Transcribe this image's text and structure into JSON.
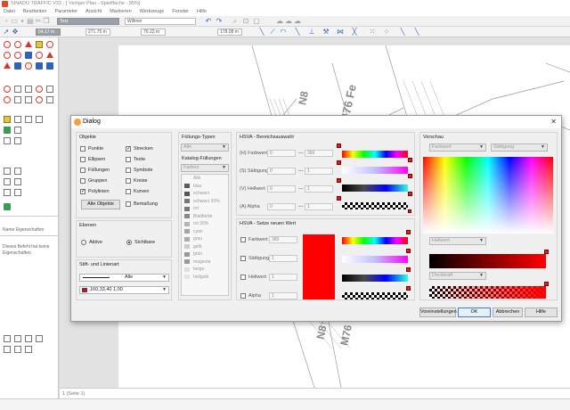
{
  "app": {
    "title": "SINADO TRAFFIC V32 - [ Verliger Plan - Spielfläche - 95%]",
    "menu": [
      "Datei",
      "Bearbeiten",
      "Parameter",
      "Ansicht",
      "Markieren",
      "Werkzeuge",
      "Fenster",
      "Hilfe"
    ],
    "toolbar": {
      "layer_select": "Text",
      "style_select": "Willmer"
    },
    "coords": {
      "x": "54.17 m",
      "y": "271.75 m",
      "w": "76.22 m",
      "h": "178.08 m"
    },
    "left_panel": {
      "properties_label": "Name Eigenschaften",
      "info_text": "Dieses Befehl hat keine Eigenschaften"
    },
    "status": {
      "page": "1 (Seite 1)"
    },
    "map_labels": [
      "N8",
      "M76 Fe",
      "N8↑",
      "M76"
    ]
  },
  "dialog": {
    "title": "Dialog",
    "close_glyph": "✕",
    "objekte": {
      "title": "Objekte",
      "items": [
        {
          "label": "Punkte",
          "checked": false
        },
        {
          "label": "Strecken",
          "checked": true
        },
        {
          "label": "Ellipsen",
          "checked": false
        },
        {
          "label": "Texte",
          "checked": false
        },
        {
          "label": "Füllungen",
          "checked": false
        },
        {
          "label": "Symbole",
          "checked": false
        },
        {
          "label": "Gruppen",
          "checked": false
        },
        {
          "label": "Kreise",
          "checked": false
        },
        {
          "label": "Polylinien",
          "checked": true
        },
        {
          "label": "Kurven",
          "checked": false
        },
        {
          "label": "Bemaßung",
          "checked": false
        }
      ],
      "all_button": "Alle Objekte"
    },
    "ebenen": {
      "title": "Ebenen",
      "options": [
        {
          "label": "Aktive",
          "selected": false
        },
        {
          "label": "Sichtbare",
          "selected": true
        }
      ]
    },
    "stift": {
      "title": "Stift- und Linienart",
      "line_value": "Alle",
      "color_value": "160,33,40 1,00"
    },
    "fuellung": {
      "title": "Füllungs-Typen",
      "type_value": "Alle",
      "catalog_title": "Katalog-Füllungen",
      "catalog_value": "Farben",
      "items": [
        {
          "label": "Alle",
          "color": ""
        },
        {
          "label": "blau",
          "color": "#5a5a5a"
        },
        {
          "label": "schwarz",
          "color": "#555"
        },
        {
          "label": "schwarz 50%",
          "color": "#777"
        },
        {
          "label": "rot",
          "color": "#777"
        },
        {
          "label": "Blattfarbe",
          "color": "#888"
        },
        {
          "label": "rot 30%",
          "color": "#b5b5b5"
        },
        {
          "label": "cyan",
          "color": "#a5a5a5"
        },
        {
          "label": "grau",
          "color": "#aaa"
        },
        {
          "label": "gelb",
          "color": "#ccc"
        },
        {
          "label": "grün",
          "color": "#999"
        },
        {
          "label": "magenta",
          "color": "#999"
        },
        {
          "label": "beige",
          "color": "#ddd"
        },
        {
          "label": "hellgelb",
          "color": "#e4e4e4"
        }
      ]
    },
    "hsva_range": {
      "title": "HSVA - Bereichsauswahl",
      "rows": [
        {
          "label": "(H) Farbwert",
          "from": "0",
          "to": "360"
        },
        {
          "label": "(S) Sättigung",
          "from": "0",
          "to": "1"
        },
        {
          "label": "(V) Hellwert",
          "from": "0",
          "to": "1"
        },
        {
          "label": "(A) Alpha",
          "from": "0",
          "to": "1"
        }
      ],
      "dash": "—"
    },
    "hsva_set": {
      "title": "HSVA - Setze neuen Wert",
      "rows": [
        {
          "label": "Farbwert",
          "value": "360"
        },
        {
          "label": "Sättigung",
          "value": "1"
        },
        {
          "label": "Hellwert",
          "value": "1"
        },
        {
          "label": "Alpha",
          "value": "1"
        }
      ],
      "preview_color": "#ff0000"
    },
    "vorschau": {
      "title": "Vorschau",
      "farbwert": "Farbwert",
      "saettigung": "Sättigung",
      "hellwert": "Hellwert",
      "deckkraft": "Deckkraft"
    },
    "buttons": {
      "presets": "Voreinstellungen",
      "ok": "OK",
      "cancel": "Abbrechen",
      "help": "Hilfe"
    }
  }
}
